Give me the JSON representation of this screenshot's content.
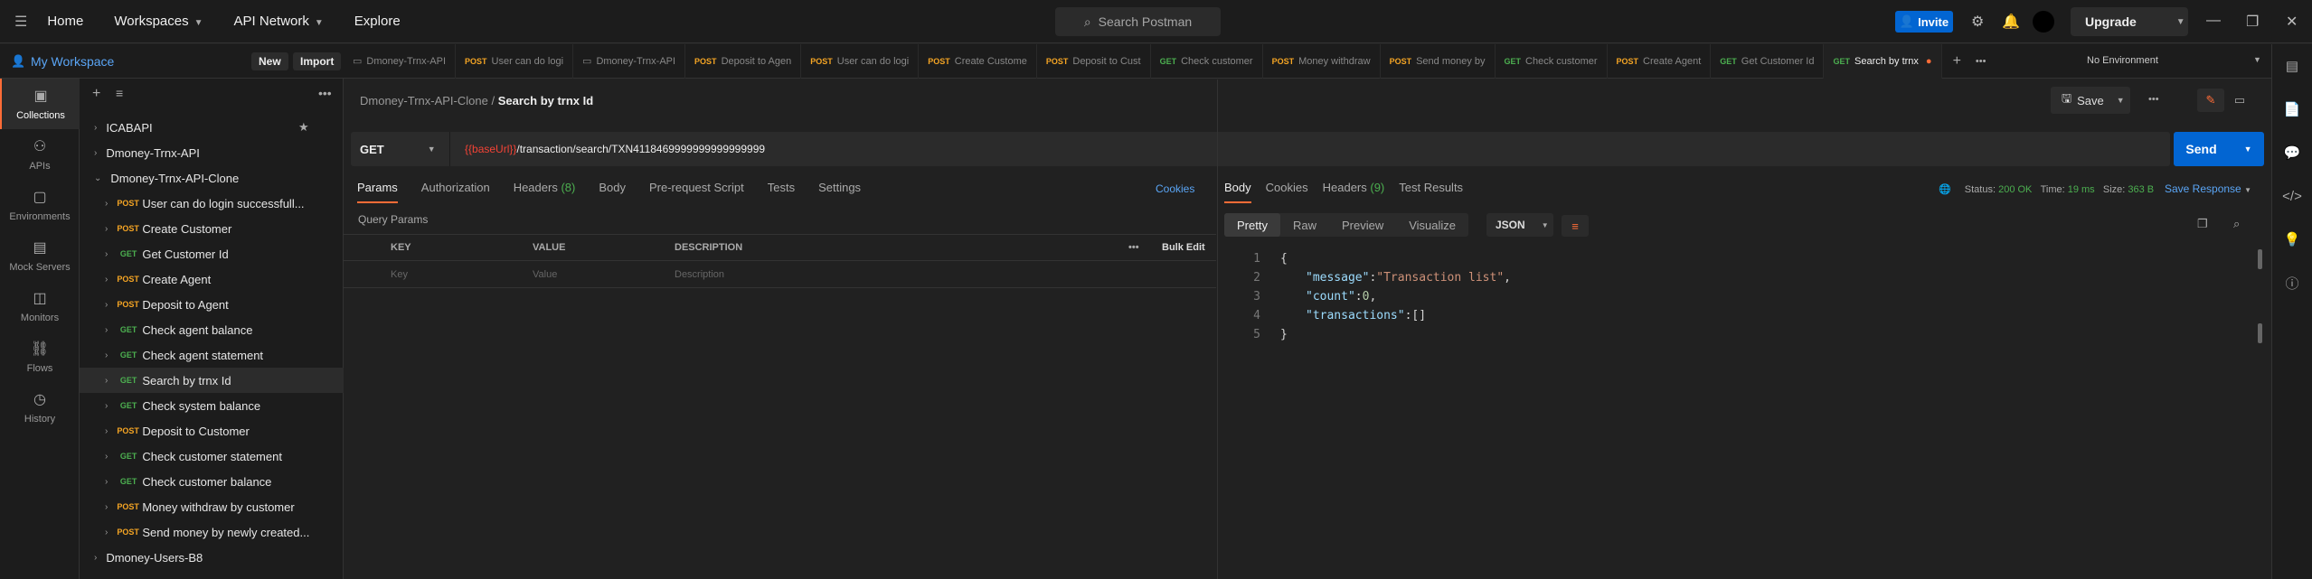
{
  "topbar": {
    "menu_icon": "menu-icon",
    "nav": [
      "Home",
      "Workspaces",
      "API Network",
      "Explore"
    ],
    "search_placeholder": "Search Postman",
    "invite_label": "Invite",
    "upgrade_label": "Upgrade"
  },
  "workspace": {
    "name": "My Workspace",
    "new_label": "New",
    "import_label": "Import"
  },
  "rail": [
    {
      "label": "Collections",
      "icon": "collections-icon"
    },
    {
      "label": "APIs",
      "icon": "apis-icon"
    },
    {
      "label": "Environments",
      "icon": "environments-icon"
    },
    {
      "label": "Mock Servers",
      "icon": "mock-servers-icon"
    },
    {
      "label": "Monitors",
      "icon": "monitors-icon"
    },
    {
      "label": "Flows",
      "icon": "flows-icon"
    },
    {
      "label": "History",
      "icon": "history-icon"
    }
  ],
  "tree": {
    "c1": "ICABAPI",
    "c2": "Dmoney-Trnx-API",
    "c3": "Dmoney-Trnx-API-Clone",
    "items": [
      {
        "method": "POST",
        "name": "User can do login successfull..."
      },
      {
        "method": "POST",
        "name": "Create Customer"
      },
      {
        "method": "GET",
        "name": "Get Customer Id"
      },
      {
        "method": "POST",
        "name": "Create Agent"
      },
      {
        "method": "POST",
        "name": "Deposit to Agent"
      },
      {
        "method": "GET",
        "name": "Check agent balance"
      },
      {
        "method": "GET",
        "name": "Check agent statement"
      },
      {
        "method": "GET",
        "name": "Search by trnx Id"
      },
      {
        "method": "GET",
        "name": "Check system balance"
      },
      {
        "method": "POST",
        "name": "Deposit to Customer"
      },
      {
        "method": "GET",
        "name": "Check customer statement"
      },
      {
        "method": "GET",
        "name": "Check customer balance"
      },
      {
        "method": "POST",
        "name": "Money withdraw by customer"
      },
      {
        "method": "POST",
        "name": "Send money by newly created..."
      }
    ],
    "c4": "Dmoney-Users-B8"
  },
  "tabs": [
    {
      "method": "",
      "name": "Dmoney-Trnx-API"
    },
    {
      "method": "POST",
      "name": "User can do logi"
    },
    {
      "method": "",
      "name": "Dmoney-Trnx-API"
    },
    {
      "method": "POST",
      "name": "Deposit to Agen"
    },
    {
      "method": "POST",
      "name": "User can do logi"
    },
    {
      "method": "POST",
      "name": "Create Custome"
    },
    {
      "method": "POST",
      "name": "Deposit to Cust"
    },
    {
      "method": "GET",
      "name": "Check customer"
    },
    {
      "method": "POST",
      "name": "Money withdraw"
    },
    {
      "method": "POST",
      "name": "Send money by"
    },
    {
      "method": "GET",
      "name": "Check customer"
    },
    {
      "method": "POST",
      "name": "Create Agent"
    },
    {
      "method": "GET",
      "name": "Get Customer Id"
    },
    {
      "method": "GET",
      "name": "Search by trnx"
    }
  ],
  "environment": "No Environment",
  "breadcrumb": {
    "parent": "Dmoney-Trnx-API-Clone",
    "sep": "/",
    "current": "Search by trnx Id"
  },
  "save_label": "Save",
  "request": {
    "method": "GET",
    "url_var": "{{baseUrl}}",
    "url_path": "/transaction/search/TXN4118469999999999999999",
    "send_label": "Send"
  },
  "request_tabs": [
    "Params",
    "Authorization",
    "Headers (8)",
    "Body",
    "Pre-request Script",
    "Tests",
    "Settings"
  ],
  "cookies_label": "Cookies",
  "query_params": {
    "title": "Query Params",
    "headers": [
      "KEY",
      "VALUE",
      "DESCRIPTION"
    ],
    "bulk_edit": "Bulk Edit",
    "placeholders": [
      "Key",
      "Value",
      "Description"
    ]
  },
  "response": {
    "tabs": [
      "Body",
      "Cookies",
      "Headers (9)",
      "Test Results"
    ],
    "status_label": "Status:",
    "status": "200 OK",
    "time_label": "Time:",
    "time": "19 ms",
    "size_label": "Size:",
    "size": "363 B",
    "save_response": "Save Response",
    "views": [
      "Pretty",
      "Raw",
      "Preview",
      "Visualize"
    ],
    "format": "JSON",
    "lines": [
      "1",
      "2",
      "3",
      "4",
      "5"
    ],
    "body": {
      "open": "{",
      "k1": "\"message\"",
      "v1": "\"Transaction list\"",
      "k2": "\"count\"",
      "v2": "0",
      "k3": "\"transactions\"",
      "v3": "[]",
      "close": "}"
    }
  }
}
